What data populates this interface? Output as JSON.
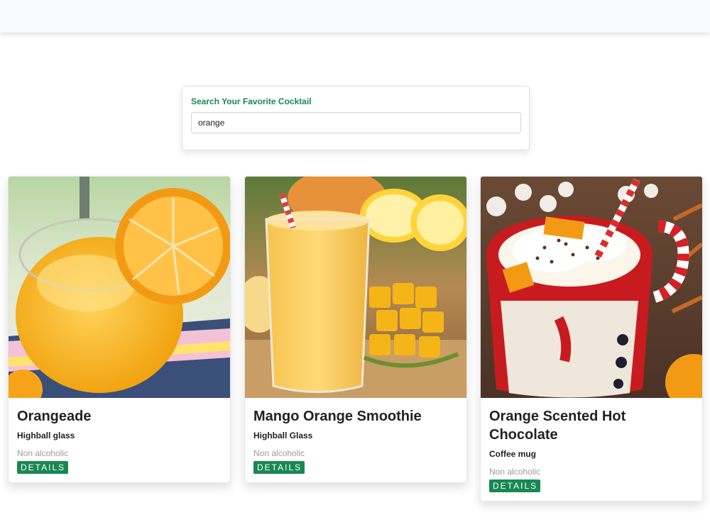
{
  "search": {
    "label": "Search Your Favorite Cocktail",
    "value": "orange"
  },
  "accent_color": "#198754",
  "drinks": [
    {
      "name": "Orangeade",
      "glass": "Highball glass",
      "alcoholic": "Non alcoholic",
      "button": "DETAILS",
      "image": "orangeade-photo"
    },
    {
      "name": "Mango Orange Smoothie",
      "glass": "Highball Glass",
      "alcoholic": "Non alcoholic",
      "button": "DETAILS",
      "image": "mango-orange-smoothie-photo"
    },
    {
      "name": "Orange Scented Hot Chocolate",
      "glass": "Coffee mug",
      "alcoholic": "Non alcoholic",
      "button": "DETAILS",
      "image": "hot-chocolate-photo"
    }
  ]
}
